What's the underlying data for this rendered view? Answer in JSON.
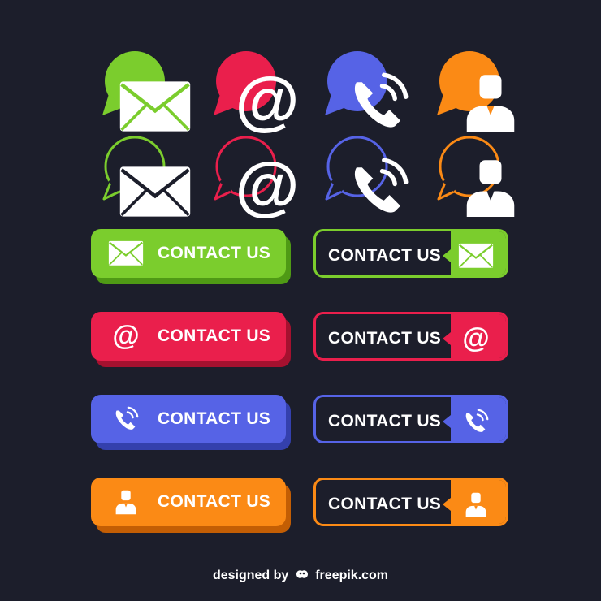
{
  "colors": {
    "background": "#1c1e2b",
    "green": "#7bcd2d",
    "green_shadow": "#4f9a15",
    "red": "#ea1f4c",
    "red_shadow": "#a4112f",
    "blue": "#5663e6",
    "blue_shadow": "#3440ad",
    "orange": "#fb8a15",
    "orange_shadow": "#c35e04"
  },
  "bubbles": [
    {
      "icon": "envelope-icon",
      "color": "green",
      "style": "filled"
    },
    {
      "icon": "at-sign-icon",
      "color": "red",
      "style": "filled"
    },
    {
      "icon": "phone-icon",
      "color": "blue",
      "style": "filled"
    },
    {
      "icon": "user-icon",
      "color": "orange",
      "style": "filled"
    },
    {
      "icon": "envelope-icon",
      "color": "green",
      "style": "outline"
    },
    {
      "icon": "at-sign-icon",
      "color": "red",
      "style": "outline"
    },
    {
      "icon": "phone-icon",
      "color": "blue",
      "style": "outline"
    },
    {
      "icon": "user-icon",
      "color": "orange",
      "style": "outline"
    }
  ],
  "buttons": {
    "label": "CONTACT US",
    "solid": [
      {
        "icon": "envelope-icon",
        "color": "green"
      },
      {
        "icon": "at-sign-icon",
        "color": "red"
      },
      {
        "icon": "phone-icon",
        "color": "blue"
      },
      {
        "icon": "user-icon",
        "color": "orange"
      }
    ],
    "outline": [
      {
        "icon": "envelope-icon",
        "color": "green"
      },
      {
        "icon": "at-sign-icon",
        "color": "red"
      },
      {
        "icon": "phone-icon",
        "color": "blue"
      },
      {
        "icon": "user-icon",
        "color": "orange"
      }
    ]
  },
  "footer": {
    "designed_by": "designed by",
    "brand": "freepik.com"
  }
}
